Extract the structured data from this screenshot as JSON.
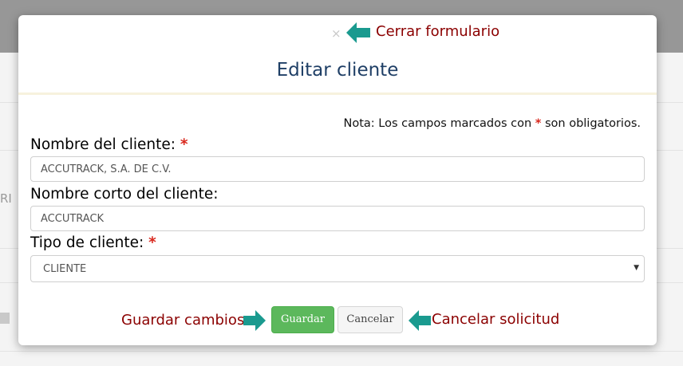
{
  "background": {
    "partial_text_left": "RI"
  },
  "modal": {
    "title": "Editar cliente",
    "close_glyph": "×",
    "note": {
      "prefix": "Nota: Los campos marcados con ",
      "asterisk": "*",
      "suffix": " son obligatorios."
    },
    "fields": {
      "client_name": {
        "label": "Nombre del cliente:",
        "required_mark": "*",
        "value": "ACCUTRACK, S.A. DE C.V."
      },
      "client_short_name": {
        "label": "Nombre corto del cliente:",
        "value": "ACCUTRACK"
      },
      "client_type": {
        "label": "Tipo de cliente:",
        "required_mark": "*",
        "selected": "CLIENTE"
      }
    },
    "buttons": {
      "save": "Guardar",
      "cancel": "Cancelar"
    }
  },
  "annotations": {
    "close_form": "Cerrar formulario",
    "save_changes": "Guardar cambios",
    "cancel_request": "Cancelar solicitud"
  },
  "colors": {
    "annotation_text": "#8b0000",
    "annotation_arrow": "#1a9a8f",
    "save_button": "#5cb85c",
    "required_mark": "#d9281e",
    "title_text": "#1f3f66"
  },
  "icons": {
    "close": "close-icon",
    "select_caret": "caret-down-icon",
    "annotation_arrow": "arrow-icon"
  }
}
